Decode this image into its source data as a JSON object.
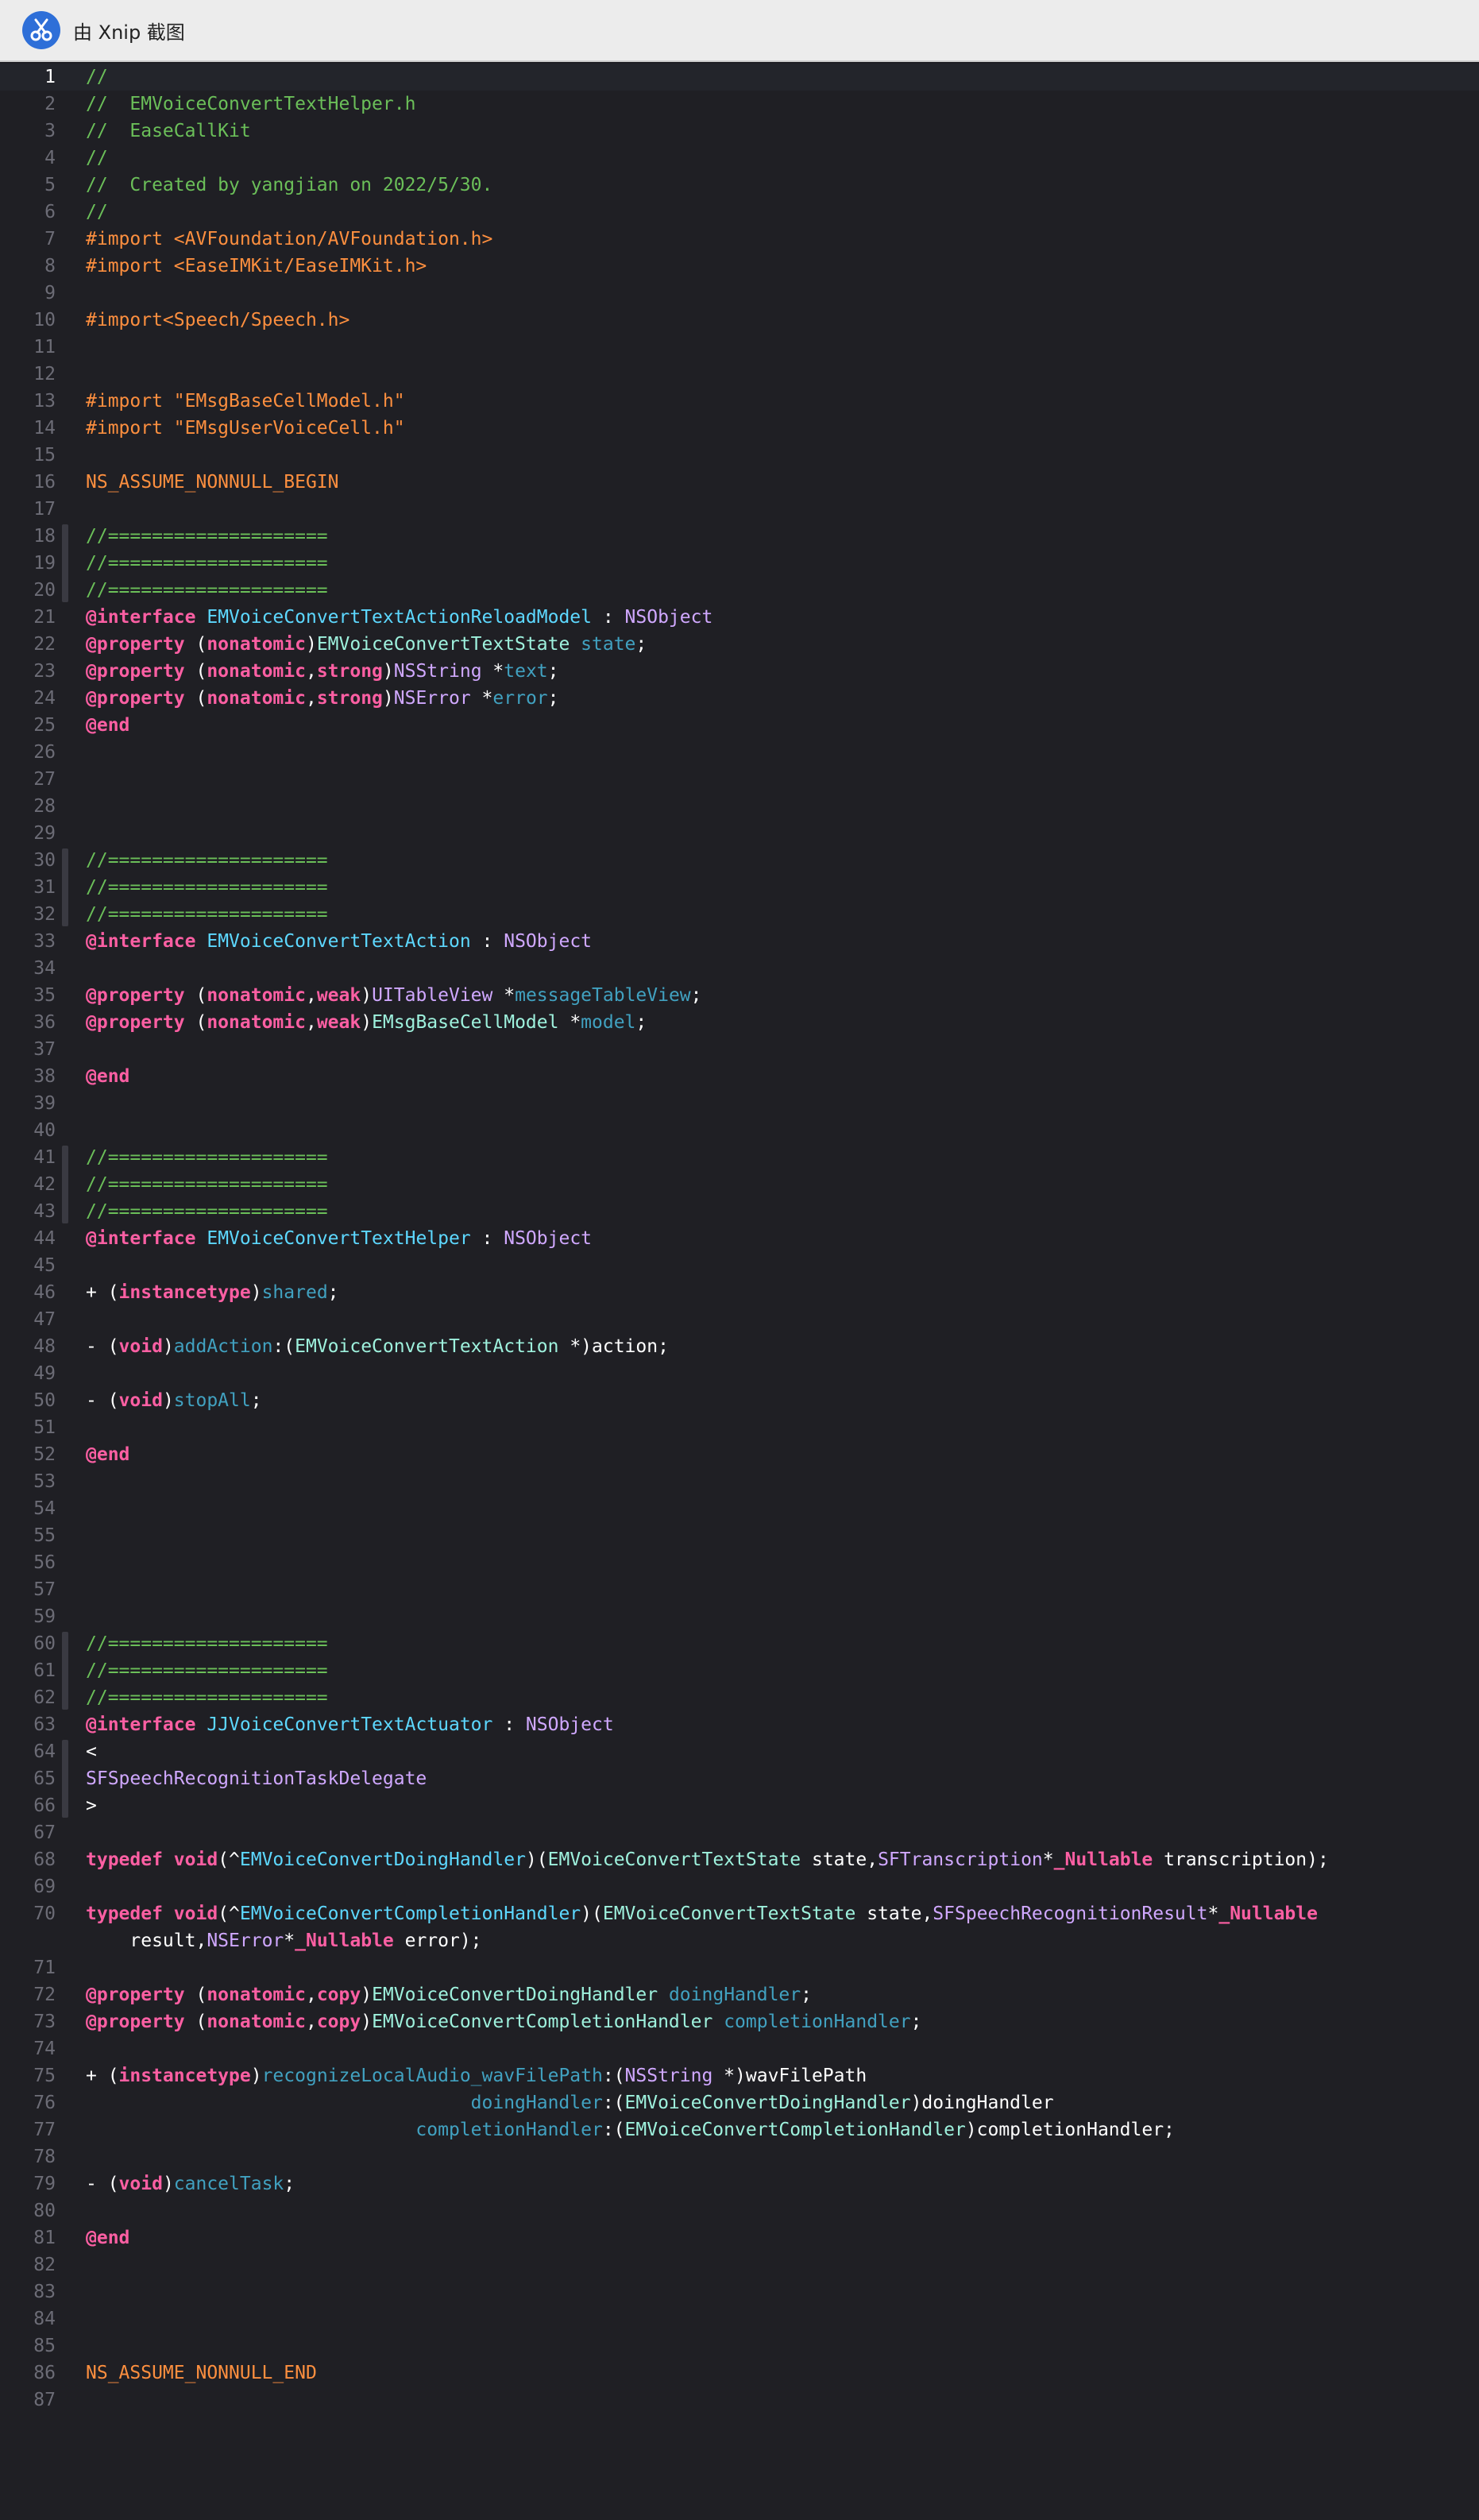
{
  "window": {
    "title": "由 Xnip 截图",
    "app_icon": "xnip-scissors-icon"
  },
  "editor": {
    "current_line": 1,
    "fold_marks": [
      [
        18,
        20
      ],
      [
        30,
        32
      ],
      [
        41,
        43
      ],
      [
        60,
        62
      ],
      [
        64,
        66
      ]
    ],
    "lines": [
      {
        "n": "1",
        "current": true,
        "segs": [
          [
            "t-com",
            "//"
          ]
        ]
      },
      {
        "n": "2",
        "segs": [
          [
            "t-com",
            "//  EMVoiceConvertTextHelper.h"
          ]
        ]
      },
      {
        "n": "3",
        "segs": [
          [
            "t-com",
            "//  EaseCallKit"
          ]
        ]
      },
      {
        "n": "4",
        "segs": [
          [
            "t-com",
            "//"
          ]
        ]
      },
      {
        "n": "5",
        "segs": [
          [
            "t-com",
            "//  Created by yangjian on 2022/5/30."
          ]
        ]
      },
      {
        "n": "6",
        "segs": [
          [
            "t-com",
            "//"
          ]
        ]
      },
      {
        "n": "7",
        "segs": [
          [
            "t-pre",
            "#import <AVFoundation/AVFoundation.h>"
          ]
        ]
      },
      {
        "n": "8",
        "segs": [
          [
            "t-pre",
            "#import <EaseIMKit/EaseIMKit.h>"
          ]
        ]
      },
      {
        "n": "9",
        "segs": []
      },
      {
        "n": "10",
        "segs": [
          [
            "t-pre",
            "#import<Speech/Speech.h>"
          ]
        ]
      },
      {
        "n": "11",
        "segs": []
      },
      {
        "n": "12",
        "segs": []
      },
      {
        "n": "13",
        "segs": [
          [
            "t-pre",
            "#import \"EMsgBaseCellModel.h\""
          ]
        ]
      },
      {
        "n": "14",
        "segs": [
          [
            "t-pre",
            "#import \"EMsgUserVoiceCell.h\""
          ]
        ]
      },
      {
        "n": "15",
        "segs": []
      },
      {
        "n": "16",
        "segs": [
          [
            "t-pre",
            "NS_ASSUME_NONNULL_BEGIN"
          ]
        ]
      },
      {
        "n": "17",
        "segs": []
      },
      {
        "n": "18",
        "segs": [
          [
            "t-com",
            "//===================="
          ]
        ]
      },
      {
        "n": "19",
        "segs": [
          [
            "t-com",
            "//===================="
          ]
        ]
      },
      {
        "n": "20",
        "segs": [
          [
            "t-com",
            "//===================="
          ]
        ]
      },
      {
        "n": "21",
        "segs": [
          [
            "t-kw",
            "@interface"
          ],
          [
            "t-plain",
            " "
          ],
          [
            "t-cls",
            "EMVoiceConvertTextActionReloadModel"
          ],
          [
            "t-plain",
            " : "
          ],
          [
            "t-typ",
            "NSObject"
          ]
        ]
      },
      {
        "n": "22",
        "segs": [
          [
            "t-kw",
            "@property"
          ],
          [
            "t-plain",
            " ("
          ],
          [
            "t-kw",
            "nonatomic"
          ],
          [
            "t-plain",
            ")"
          ],
          [
            "t-proj",
            "EMVoiceConvertTextState"
          ],
          [
            "t-plain",
            " "
          ],
          [
            "t-id",
            "state"
          ],
          [
            "t-plain",
            ";"
          ]
        ]
      },
      {
        "n": "23",
        "segs": [
          [
            "t-kw",
            "@property"
          ],
          [
            "t-plain",
            " ("
          ],
          [
            "t-kw",
            "nonatomic"
          ],
          [
            "t-plain",
            ","
          ],
          [
            "t-kw",
            "strong"
          ],
          [
            "t-plain",
            ")"
          ],
          [
            "t-typ",
            "NSString"
          ],
          [
            "t-plain",
            " *"
          ],
          [
            "t-id",
            "text"
          ],
          [
            "t-plain",
            ";"
          ]
        ]
      },
      {
        "n": "24",
        "segs": [
          [
            "t-kw",
            "@property"
          ],
          [
            "t-plain",
            " ("
          ],
          [
            "t-kw",
            "nonatomic"
          ],
          [
            "t-plain",
            ","
          ],
          [
            "t-kw",
            "strong"
          ],
          [
            "t-plain",
            ")"
          ],
          [
            "t-typ",
            "NSError"
          ],
          [
            "t-plain",
            " *"
          ],
          [
            "t-id",
            "error"
          ],
          [
            "t-plain",
            ";"
          ]
        ]
      },
      {
        "n": "25",
        "segs": [
          [
            "t-kw",
            "@end"
          ]
        ]
      },
      {
        "n": "26",
        "segs": []
      },
      {
        "n": "27",
        "segs": []
      },
      {
        "n": "28",
        "segs": []
      },
      {
        "n": "29",
        "segs": []
      },
      {
        "n": "30",
        "segs": [
          [
            "t-com",
            "//===================="
          ]
        ]
      },
      {
        "n": "31",
        "segs": [
          [
            "t-com",
            "//===================="
          ]
        ]
      },
      {
        "n": "32",
        "segs": [
          [
            "t-com",
            "//===================="
          ]
        ]
      },
      {
        "n": "33",
        "segs": [
          [
            "t-kw",
            "@interface"
          ],
          [
            "t-plain",
            " "
          ],
          [
            "t-cls",
            "EMVoiceConvertTextAction"
          ],
          [
            "t-plain",
            " : "
          ],
          [
            "t-typ",
            "NSObject"
          ]
        ]
      },
      {
        "n": "34",
        "segs": []
      },
      {
        "n": "35",
        "segs": [
          [
            "t-kw",
            "@property"
          ],
          [
            "t-plain",
            " ("
          ],
          [
            "t-kw",
            "nonatomic"
          ],
          [
            "t-plain",
            ","
          ],
          [
            "t-kw",
            "weak"
          ],
          [
            "t-plain",
            ")"
          ],
          [
            "t-typ",
            "UITableView"
          ],
          [
            "t-plain",
            " *"
          ],
          [
            "t-id",
            "messageTableView"
          ],
          [
            "t-plain",
            ";"
          ]
        ]
      },
      {
        "n": "36",
        "segs": [
          [
            "t-kw",
            "@property"
          ],
          [
            "t-plain",
            " ("
          ],
          [
            "t-kw",
            "nonatomic"
          ],
          [
            "t-plain",
            ","
          ],
          [
            "t-kw",
            "weak"
          ],
          [
            "t-plain",
            ")"
          ],
          [
            "t-proj",
            "EMsgBaseCellModel"
          ],
          [
            "t-plain",
            " *"
          ],
          [
            "t-id",
            "model"
          ],
          [
            "t-plain",
            ";"
          ]
        ]
      },
      {
        "n": "37",
        "segs": []
      },
      {
        "n": "38",
        "segs": [
          [
            "t-kw",
            "@end"
          ]
        ]
      },
      {
        "n": "39",
        "segs": []
      },
      {
        "n": "40",
        "segs": []
      },
      {
        "n": "41",
        "segs": [
          [
            "t-com",
            "//===================="
          ]
        ]
      },
      {
        "n": "42",
        "segs": [
          [
            "t-com",
            "//===================="
          ]
        ]
      },
      {
        "n": "43",
        "segs": [
          [
            "t-com",
            "//===================="
          ]
        ]
      },
      {
        "n": "44",
        "segs": [
          [
            "t-kw",
            "@interface"
          ],
          [
            "t-plain",
            " "
          ],
          [
            "t-cls",
            "EMVoiceConvertTextHelper"
          ],
          [
            "t-plain",
            " : "
          ],
          [
            "t-typ",
            "NSObject"
          ]
        ]
      },
      {
        "n": "45",
        "segs": []
      },
      {
        "n": "46",
        "segs": [
          [
            "t-plain",
            "+ ("
          ],
          [
            "t-kw",
            "instancetype"
          ],
          [
            "t-plain",
            ")"
          ],
          [
            "t-id",
            "shared"
          ],
          [
            "t-plain",
            ";"
          ]
        ]
      },
      {
        "n": "47",
        "segs": []
      },
      {
        "n": "48",
        "segs": [
          [
            "t-plain",
            "- ("
          ],
          [
            "t-kw",
            "void"
          ],
          [
            "t-plain",
            ")"
          ],
          [
            "t-id",
            "addAction"
          ],
          [
            "t-plain",
            ":("
          ],
          [
            "t-proj",
            "EMVoiceConvertTextAction"
          ],
          [
            "t-plain",
            " *)action;"
          ]
        ]
      },
      {
        "n": "49",
        "segs": []
      },
      {
        "n": "50",
        "segs": [
          [
            "t-plain",
            "- ("
          ],
          [
            "t-kw",
            "void"
          ],
          [
            "t-plain",
            ")"
          ],
          [
            "t-id",
            "stopAll"
          ],
          [
            "t-plain",
            ";"
          ]
        ]
      },
      {
        "n": "51",
        "segs": []
      },
      {
        "n": "52",
        "segs": [
          [
            "t-kw",
            "@end"
          ]
        ]
      },
      {
        "n": "53",
        "segs": []
      },
      {
        "n": "54",
        "segs": []
      },
      {
        "n": "55",
        "segs": []
      },
      {
        "n": "56",
        "segs": []
      },
      {
        "n": "57",
        "segs": []
      },
      {
        "n": "59",
        "segs": []
      },
      {
        "n": "60",
        "segs": [
          [
            "t-com",
            "//===================="
          ]
        ]
      },
      {
        "n": "61",
        "segs": [
          [
            "t-com",
            "//===================="
          ]
        ]
      },
      {
        "n": "62",
        "segs": [
          [
            "t-com",
            "//===================="
          ]
        ]
      },
      {
        "n": "63",
        "segs": [
          [
            "t-kw",
            "@interface"
          ],
          [
            "t-plain",
            " "
          ],
          [
            "t-cls",
            "JJVoiceConvertTextActuator"
          ],
          [
            "t-plain",
            " : "
          ],
          [
            "t-typ",
            "NSObject"
          ]
        ]
      },
      {
        "n": "64",
        "segs": [
          [
            "t-plain",
            "<"
          ]
        ]
      },
      {
        "n": "65",
        "segs": [
          [
            "t-typ",
            "SFSpeechRecognitionTaskDelegate"
          ]
        ]
      },
      {
        "n": "66",
        "segs": [
          [
            "t-plain",
            ">"
          ]
        ]
      },
      {
        "n": "67",
        "segs": []
      },
      {
        "n": "68",
        "segs": [
          [
            "t-kw",
            "typedef"
          ],
          [
            "t-plain",
            " "
          ],
          [
            "t-kw",
            "void"
          ],
          [
            "t-plain",
            "(^"
          ],
          [
            "t-cls",
            "EMVoiceConvertDoingHandler"
          ],
          [
            "t-plain",
            ")("
          ],
          [
            "t-proj",
            "EMVoiceConvertTextState"
          ],
          [
            "t-plain",
            " state,"
          ],
          [
            "t-typ",
            "SFTranscription"
          ],
          [
            "t-plain",
            "*"
          ],
          [
            "t-kw",
            "_Nullable"
          ],
          [
            "t-plain",
            " transcription);"
          ]
        ]
      },
      {
        "n": "69",
        "segs": []
      },
      {
        "n": "70",
        "segs": [
          [
            "t-kw",
            "typedef"
          ],
          [
            "t-plain",
            " "
          ],
          [
            "t-kw",
            "void"
          ],
          [
            "t-plain",
            "(^"
          ],
          [
            "t-cls",
            "EMVoiceConvertCompletionHandler"
          ],
          [
            "t-plain",
            ")("
          ],
          [
            "t-proj",
            "EMVoiceConvertTextState"
          ],
          [
            "t-plain",
            " state,"
          ],
          [
            "t-typ",
            "SFSpeechRecognitionResult"
          ],
          [
            "t-plain",
            "*"
          ],
          [
            "t-kw",
            "_Nullable"
          ]
        ]
      },
      {
        "n": "",
        "segs": [
          [
            "t-plain",
            "    result,"
          ],
          [
            "t-typ",
            "NSError"
          ],
          [
            "t-plain",
            "*"
          ],
          [
            "t-kw",
            "_Nullable"
          ],
          [
            "t-plain",
            " error);"
          ]
        ]
      },
      {
        "n": "71",
        "segs": []
      },
      {
        "n": "72",
        "segs": [
          [
            "t-kw",
            "@property"
          ],
          [
            "t-plain",
            " ("
          ],
          [
            "t-kw",
            "nonatomic"
          ],
          [
            "t-plain",
            ","
          ],
          [
            "t-kw",
            "copy"
          ],
          [
            "t-plain",
            ")"
          ],
          [
            "t-proj",
            "EMVoiceConvertDoingHandler"
          ],
          [
            "t-plain",
            " "
          ],
          [
            "t-id",
            "doingHandler"
          ],
          [
            "t-plain",
            ";"
          ]
        ]
      },
      {
        "n": "73",
        "segs": [
          [
            "t-kw",
            "@property"
          ],
          [
            "t-plain",
            " ("
          ],
          [
            "t-kw",
            "nonatomic"
          ],
          [
            "t-plain",
            ","
          ],
          [
            "t-kw",
            "copy"
          ],
          [
            "t-plain",
            ")"
          ],
          [
            "t-proj",
            "EMVoiceConvertCompletionHandler"
          ],
          [
            "t-plain",
            " "
          ],
          [
            "t-id",
            "completionHandler"
          ],
          [
            "t-plain",
            ";"
          ]
        ]
      },
      {
        "n": "74",
        "segs": []
      },
      {
        "n": "75",
        "segs": [
          [
            "t-plain",
            "+ ("
          ],
          [
            "t-kw",
            "instancetype"
          ],
          [
            "t-plain",
            ")"
          ],
          [
            "t-id",
            "recognizeLocalAudio_wavFilePath"
          ],
          [
            "t-plain",
            ":("
          ],
          [
            "t-typ",
            "NSString"
          ],
          [
            "t-plain",
            " *)wavFilePath"
          ]
        ]
      },
      {
        "n": "76",
        "segs": [
          [
            "t-plain",
            "                                   "
          ],
          [
            "t-id",
            "doingHandler"
          ],
          [
            "t-plain",
            ":("
          ],
          [
            "t-proj",
            "EMVoiceConvertDoingHandler"
          ],
          [
            "t-plain",
            ")doingHandler"
          ]
        ]
      },
      {
        "n": "77",
        "segs": [
          [
            "t-plain",
            "                              "
          ],
          [
            "t-id",
            "completionHandler"
          ],
          [
            "t-plain",
            ":("
          ],
          [
            "t-proj",
            "EMVoiceConvertCompletionHandler"
          ],
          [
            "t-plain",
            ")completionHandler;"
          ]
        ]
      },
      {
        "n": "78",
        "segs": []
      },
      {
        "n": "79",
        "segs": [
          [
            "t-plain",
            "- ("
          ],
          [
            "t-kw",
            "void"
          ],
          [
            "t-plain",
            ")"
          ],
          [
            "t-id",
            "cancelTask"
          ],
          [
            "t-plain",
            ";"
          ]
        ]
      },
      {
        "n": "80",
        "segs": []
      },
      {
        "n": "81",
        "segs": [
          [
            "t-kw",
            "@end"
          ]
        ]
      },
      {
        "n": "82",
        "segs": []
      },
      {
        "n": "83",
        "segs": []
      },
      {
        "n": "84",
        "segs": []
      },
      {
        "n": "85",
        "segs": []
      },
      {
        "n": "86",
        "segs": [
          [
            "t-pre",
            "NS_ASSUME_NONNULL_END"
          ]
        ]
      },
      {
        "n": "87",
        "segs": []
      }
    ]
  }
}
